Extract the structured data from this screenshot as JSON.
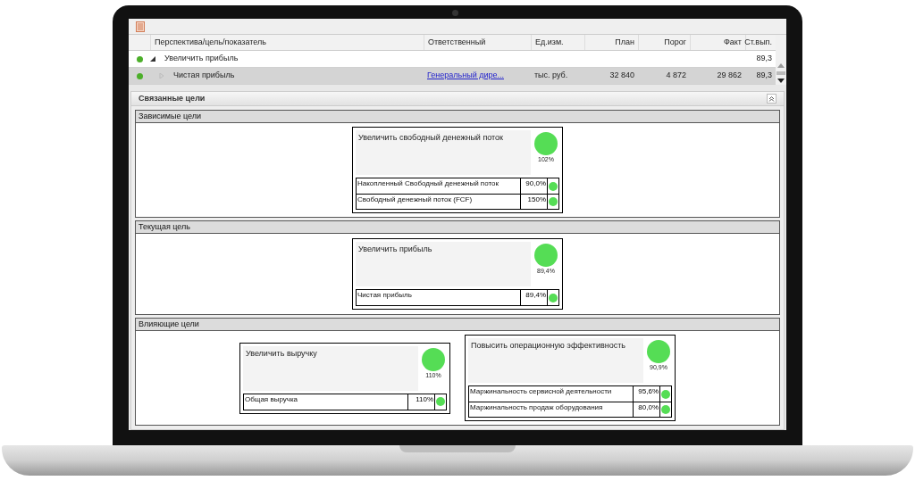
{
  "table": {
    "columns": [
      "Перспектива/цель/показатель",
      "Ответственный",
      "Ед.изм.",
      "План",
      "Порог",
      "Факт",
      "Ст.вып."
    ],
    "rows": [
      {
        "color": "#4caf2a",
        "expanded": true,
        "selected": false,
        "name": "Увеличить прибыль",
        "responsible": "",
        "unit": "",
        "plan": "",
        "threshold": "",
        "fact": "",
        "performance": "89,3",
        "children": [
          {
            "color": "#4caf2a",
            "selected": true,
            "name": "Чистая прибыль",
            "responsible": "Генеральный дире...",
            "unit": "тыс. руб.",
            "plan": "32 840",
            "threshold": "4 872",
            "fact": "29 862",
            "performance": "89,3"
          }
        ]
      }
    ]
  },
  "related": {
    "title": "Связанные цели",
    "panels": [
      {
        "title": "Зависимые цели",
        "goals": [
          {
            "title": "Увеличить свободный денежный поток",
            "percent": "102%",
            "color": "#55dd55",
            "indicators": [
              {
                "name": "Накопленный Свободный денежный поток",
                "percent": "90,0%",
                "color": "#55dd55"
              },
              {
                "name": "Свободный денежный поток (FCF)",
                "percent": "150%",
                "color": "#55dd55"
              }
            ]
          }
        ]
      },
      {
        "title": "Текущая цель",
        "goals": [
          {
            "title": "Увеличить прибыль",
            "percent": "89,4%",
            "color": "#55dd55",
            "indicators": [
              {
                "name": "Чистая прибыль",
                "percent": "89,4%",
                "color": "#55dd55"
              }
            ]
          }
        ]
      },
      {
        "title": "Влияющие цели",
        "goals": [
          {
            "title": "Увеличить выручку",
            "percent": "110%",
            "color": "#55dd55",
            "indicators": [
              {
                "name": "Общая выручка",
                "percent": "110%",
                "color": "#55dd55"
              }
            ]
          },
          {
            "title": "Повысить операционную эффективность",
            "percent": "90,9%",
            "color": "#55dd55",
            "indicators": [
              {
                "name": "Маржинальность сервисной деятельности",
                "percent": "95,6%",
                "color": "#55dd55"
              },
              {
                "name": "Маржинальность продаж оборудования",
                "percent": "80,0%",
                "color": "#55dd55"
              }
            ]
          }
        ]
      }
    ]
  }
}
